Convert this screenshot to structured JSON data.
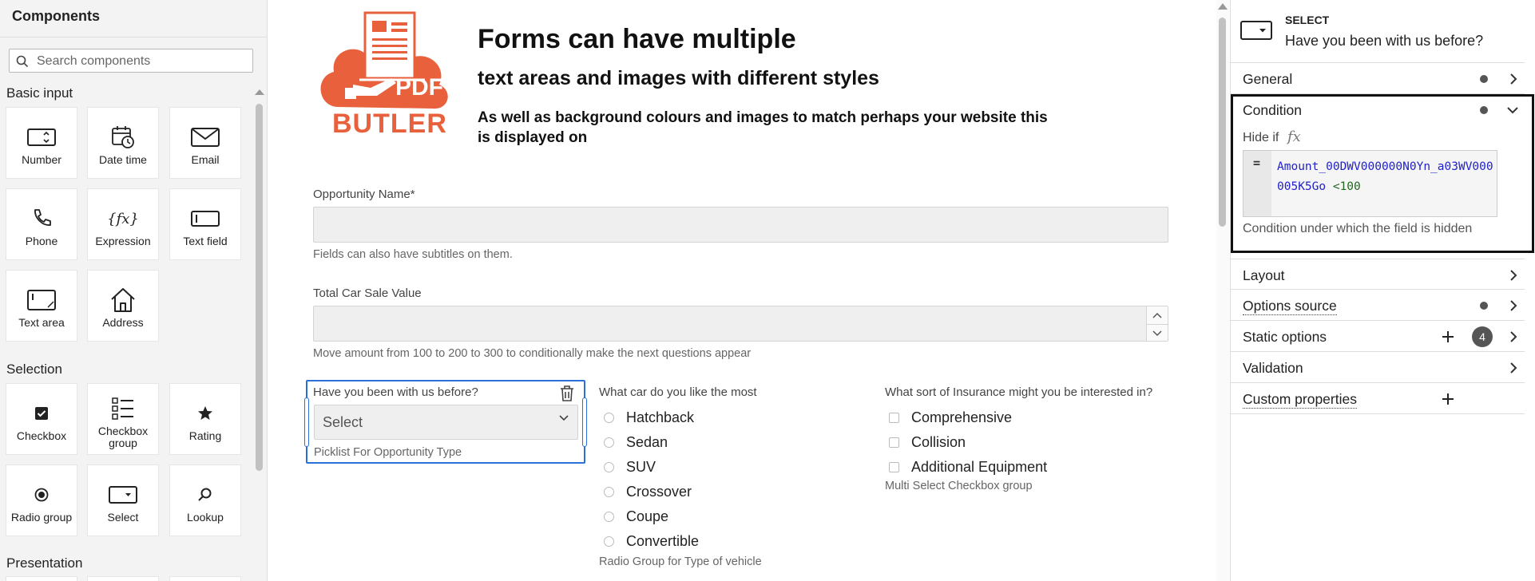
{
  "left_panel": {
    "title": "Components",
    "search_placeholder": "Search components",
    "sections": {
      "basic_input": "Basic input",
      "selection": "Selection",
      "presentation": "Presentation"
    },
    "tiles": {
      "number": "Number",
      "date_time": "Date time",
      "email": "Email",
      "phone": "Phone",
      "expression": "Expression",
      "text_field": "Text field",
      "text_area": "Text area",
      "address": "Address",
      "checkbox": "Checkbox",
      "checkbox_group": "Checkbox group",
      "rating": "Rating",
      "radio_group": "Radio group",
      "select": "Select",
      "lookup": "Lookup"
    }
  },
  "canvas": {
    "logo": {
      "line1": "PDF",
      "line2": "BUTLER"
    },
    "heading1": "Forms can have multiple",
    "heading2": "text areas and images with different styles",
    "heading3": "As well as background colours and images to match perhaps your website this is displayed on",
    "opportunity": {
      "label": "Opportunity Name*",
      "subtitle": "Fields can also have subtitles on them."
    },
    "car_sale": {
      "label": "Total Car Sale Value",
      "subtitle": "Move amount from 100 to 200 to 300 to conditionally make the next questions appear"
    },
    "select_field": {
      "label": "Have you been with us before?",
      "placeholder": "Select",
      "subtitle": "Picklist For Opportunity Type"
    },
    "car_radio": {
      "label": "What car do you like the most",
      "options": [
        "Hatchback",
        "Sedan",
        "SUV",
        "Crossover",
        "Coupe",
        "Convertible"
      ],
      "subtitle": "Radio Group for Type of vehicle"
    },
    "insurance": {
      "label": "What sort of Insurance might you be interested in?",
      "options": [
        "Comprehensive",
        "Collision",
        "Additional Equipment"
      ],
      "subtitle": "Multi Select Checkbox group"
    }
  },
  "right_panel": {
    "type": "SELECT",
    "field_title": "Have you been with us before?",
    "general": "General",
    "condition": {
      "title": "Condition",
      "hide_if": "Hide if",
      "fx": "fx",
      "eq": "=",
      "expr_field": "Amount_00DWV000000N0Yn_a03WV000005K5Go",
      "expr_op": "<100",
      "hint": "Condition under which the field is hidden"
    },
    "layout": "Layout",
    "options_source": "Options source",
    "static_options": "Static options",
    "static_options_count": "4",
    "validation": "Validation",
    "custom_properties": "Custom properties"
  },
  "colors": {
    "accent": "#2970d8",
    "logo": "#e8613c"
  }
}
